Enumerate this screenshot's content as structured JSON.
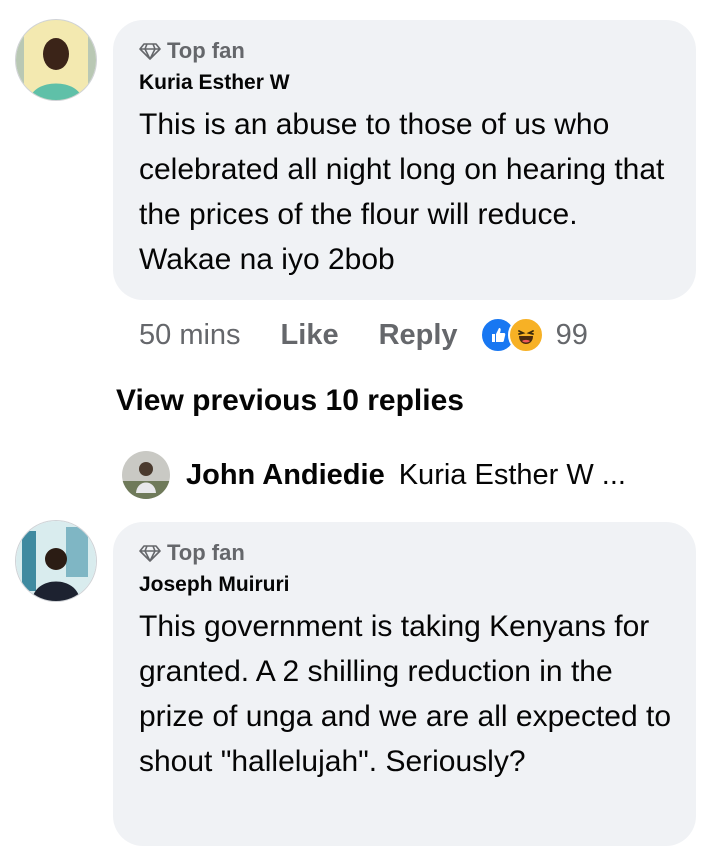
{
  "comments": [
    {
      "badge": "Top fan",
      "author": "Kuria Esther W",
      "text": "This is an abuse to those of us who celebrated all night long on hearing that the prices of the flour will reduce. Wakae na iyo 2bob",
      "avatar_icon": "profile-photo"
    },
    {
      "badge": "Top fan",
      "author": "Joseph Muiruri",
      "text": "This government is taking Kenyans for granted. A 2 shilling reduction in the prize of unga and we are all expected to shout \"hallelujah\". Seriously?",
      "avatar_icon": "profile-photo"
    }
  ],
  "actions": {
    "time": "50 mins",
    "like": "Like",
    "reply": "Reply",
    "reaction_count": "99",
    "reaction_icons": [
      "like-reaction",
      "haha-reaction"
    ]
  },
  "view_previous": "View previous 10 replies",
  "reply_preview": {
    "name": "John Andiedie",
    "text": "Kuria Esther W ..."
  },
  "colors": {
    "bubble": "#f0f2f5",
    "secondary_text": "#65676b",
    "like_blue": "#1877f2",
    "haha_yellow": "#f7b125"
  }
}
